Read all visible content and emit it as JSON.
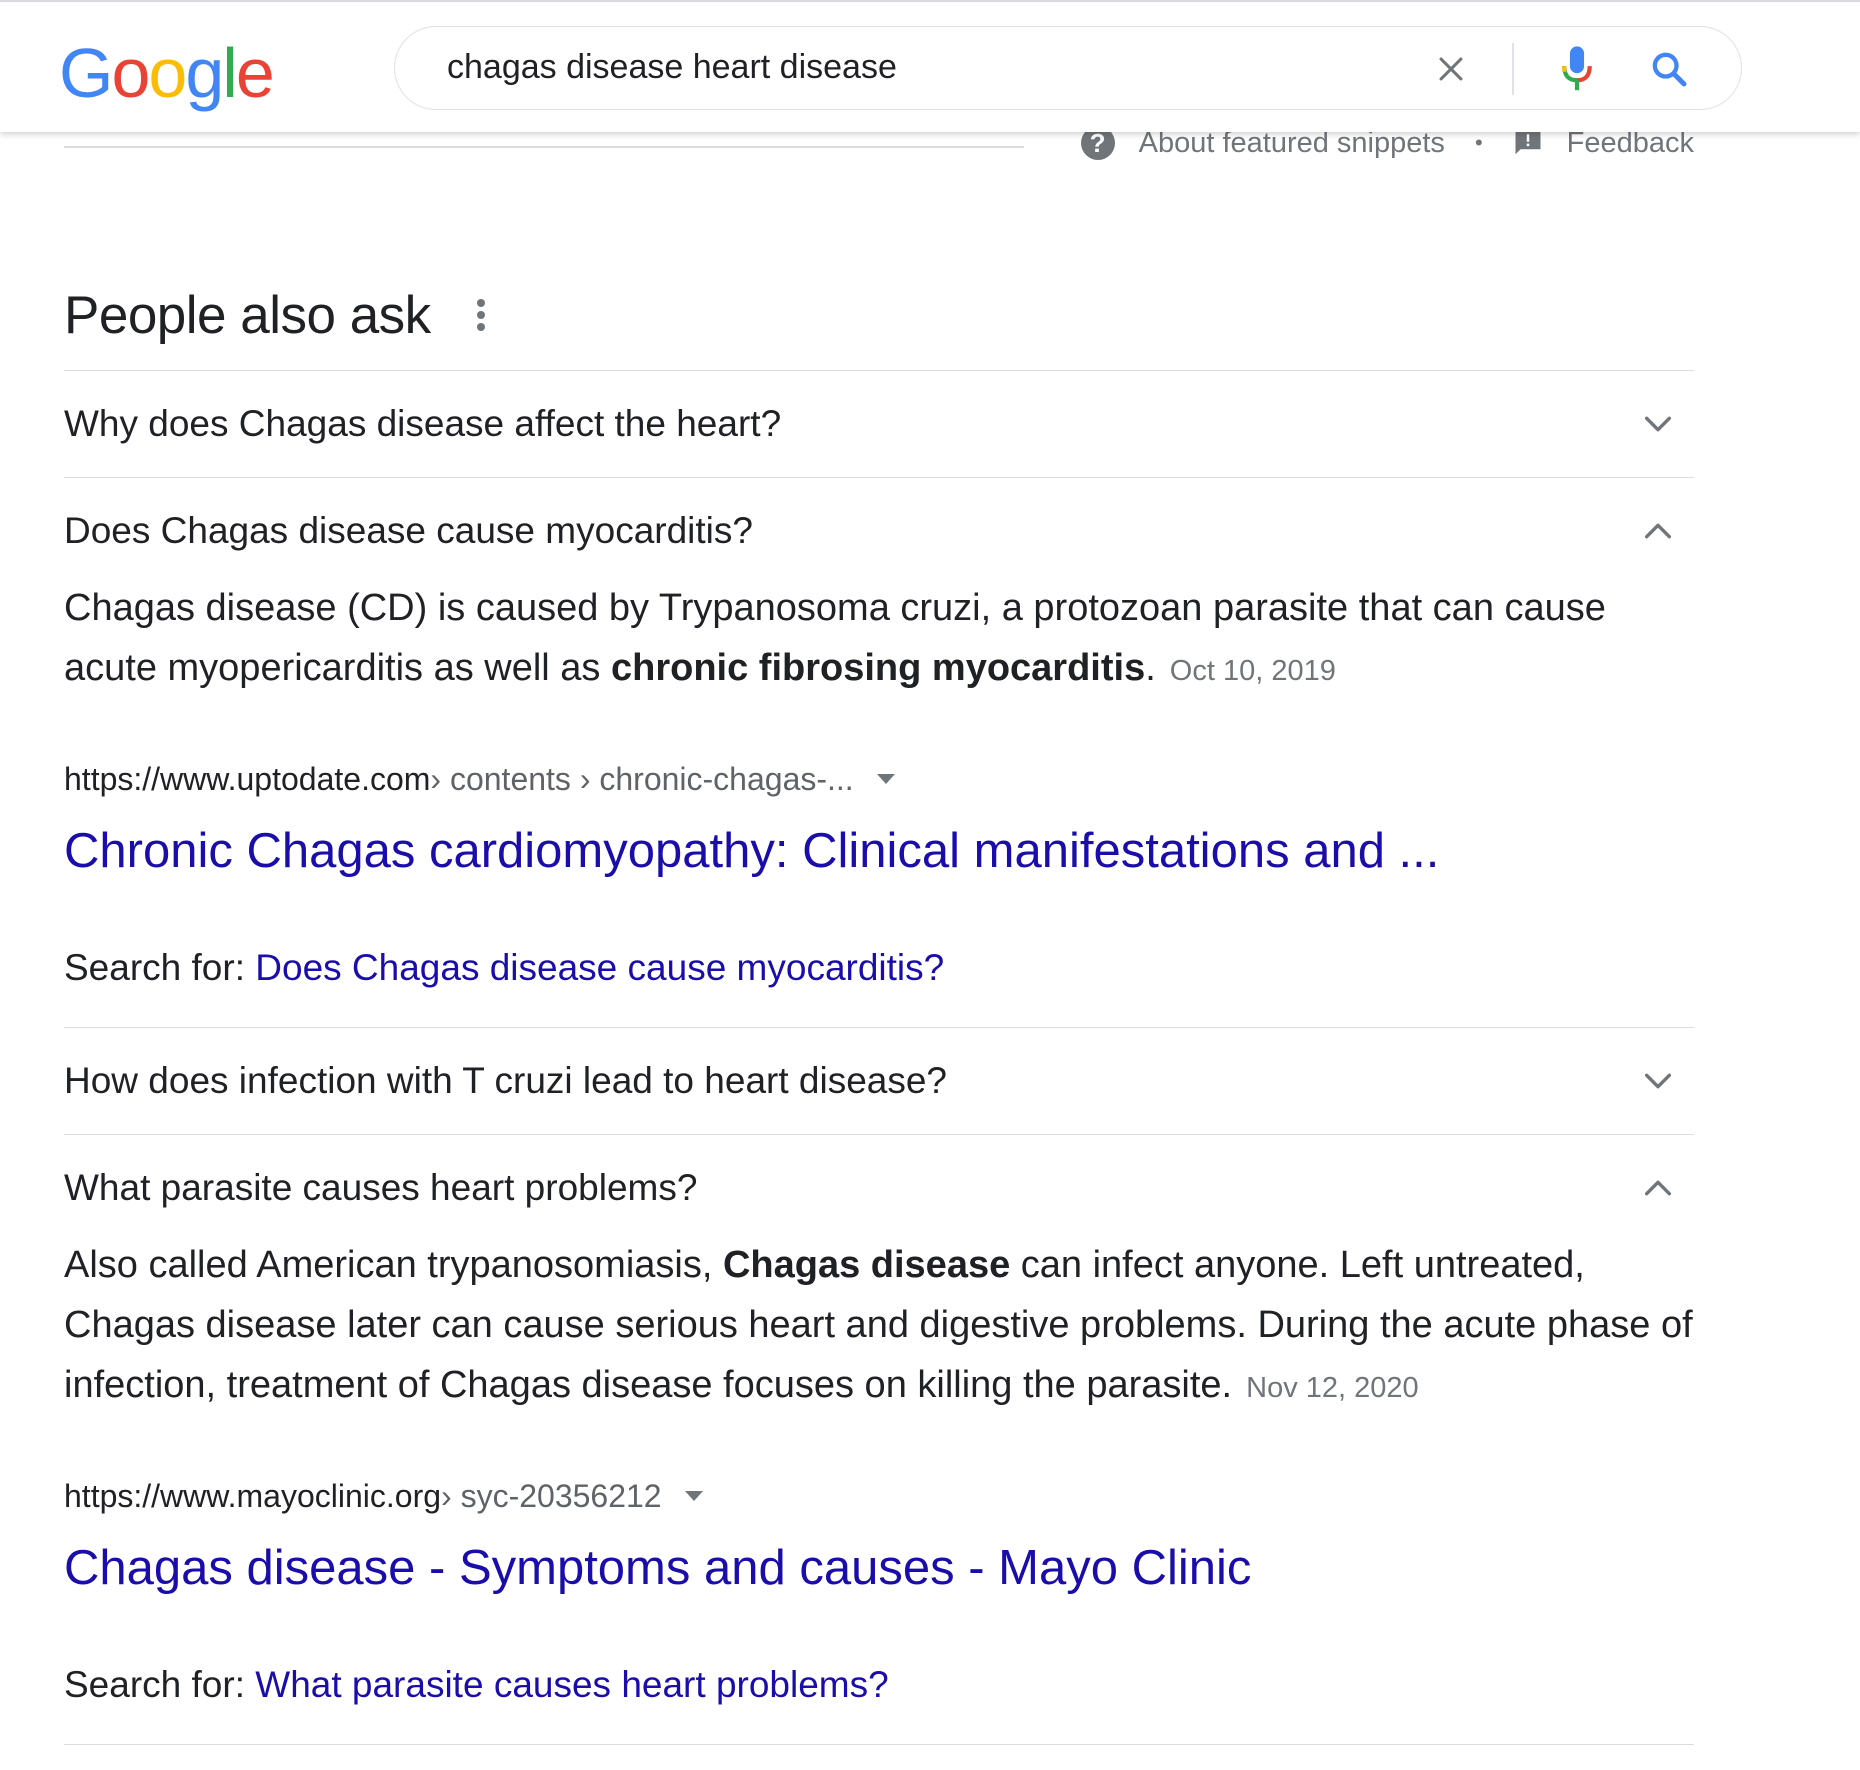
{
  "search": {
    "query": "chagas disease heart disease"
  },
  "logo": {
    "letters": [
      "G",
      "o",
      "o",
      "g",
      "l",
      "e"
    ],
    "colors": [
      "#4285F4",
      "#EA4335",
      "#FBBC05",
      "#4285F4",
      "#34A853",
      "#EA4335"
    ]
  },
  "snippet_footer": {
    "about_label": "About featured snippets",
    "separator": "•",
    "feedback_label": "Feedback"
  },
  "paa": {
    "title": "People also ask",
    "search_for_label": "Search for:",
    "items": [
      {
        "question": "Why does Chagas disease affect the heart?",
        "expanded": false
      },
      {
        "question": "Does Chagas disease cause myocarditis?",
        "expanded": true,
        "answer_parts": [
          "Chagas disease (CD) is caused by Trypanosoma cruzi, a protozoan parasite that can cause acute myopericarditis as well as ",
          "chronic fibrosing myocarditis",
          "."
        ],
        "date": "Oct 10, 2019",
        "url_domain": "https://www.uptodate.com",
        "url_path": " › contents › chronic-chagas-...",
        "result_title": "Chronic Chagas cardiomyopathy: Clinical manifestations and ...",
        "search_for_query": "Does Chagas disease cause myocarditis?"
      },
      {
        "question": "How does infection with T cruzi lead to heart disease?",
        "expanded": false
      },
      {
        "question": "What parasite causes heart problems?",
        "expanded": true,
        "answer_parts": [
          "Also called American trypanosomiasis, ",
          "Chagas disease",
          " can infect anyone. Left untreated, Chagas disease later can cause serious heart and digestive problems. During the acute phase of infection, treatment of Chagas disease focuses on killing the parasite."
        ],
        "date": "Nov 12, 2020",
        "url_domain": "https://www.mayoclinic.org",
        "url_path": " › syc-20356212",
        "result_title": "Chagas disease - Symptoms and causes - Mayo Clinic",
        "search_for_query": "What parasite causes heart problems?"
      }
    ]
  },
  "colors": {
    "link": "#1a0dab",
    "text": "#202124",
    "muted": "#70757a",
    "divider": "#dadce0",
    "search_blue": "#4285F4"
  }
}
